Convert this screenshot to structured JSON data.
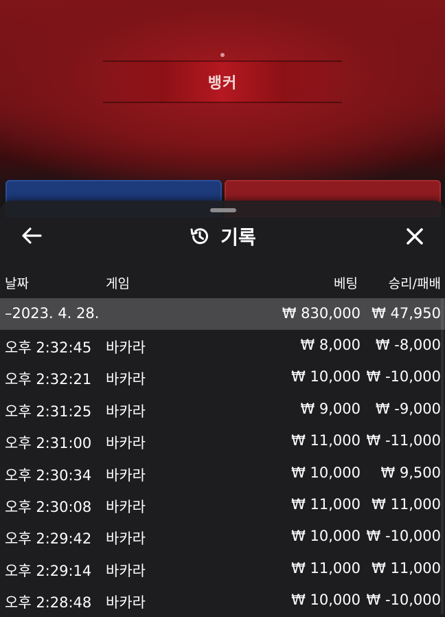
{
  "game": {
    "banner_label": "뱅커"
  },
  "header": {
    "title": "기록",
    "back_icon": "arrow-left-icon",
    "history_icon": "history-icon",
    "close_icon": "close-icon"
  },
  "columns": {
    "date": "날짜",
    "game": "게임",
    "bet": "베팅",
    "result": "승리/패배"
  },
  "summary": {
    "date": "–2023. 4. 28.",
    "bet": "₩ 830,000",
    "result": "₩ 47,950"
  },
  "rows": [
    {
      "time": "오후 2:32:45",
      "game": "바카라",
      "bet": "₩ 8,000",
      "result": "₩ -8,000"
    },
    {
      "time": "오후 2:32:21",
      "game": "바카라",
      "bet": "₩ 10,000",
      "result": "₩ -10,000"
    },
    {
      "time": "오후 2:31:25",
      "game": "바카라",
      "bet": "₩ 9,000",
      "result": "₩ -9,000"
    },
    {
      "time": "오후 2:31:00",
      "game": "바카라",
      "bet": "₩ 11,000",
      "result": "₩ -11,000"
    },
    {
      "time": "오후 2:30:34",
      "game": "바카라",
      "bet": "₩ 10,000",
      "result": "₩ 9,500"
    },
    {
      "time": "오후 2:30:08",
      "game": "바카라",
      "bet": "₩ 11,000",
      "result": "₩ 11,000"
    },
    {
      "time": "오후 2:29:42",
      "game": "바카라",
      "bet": "₩ 10,000",
      "result": "₩ -10,000"
    },
    {
      "time": "오후 2:29:14",
      "game": "바카라",
      "bet": "₩ 11,000",
      "result": "₩ 11,000"
    },
    {
      "time": "오후 2:28:48",
      "game": "바카라",
      "bet": "₩ 10,000",
      "result": "₩ -10,000"
    }
  ]
}
